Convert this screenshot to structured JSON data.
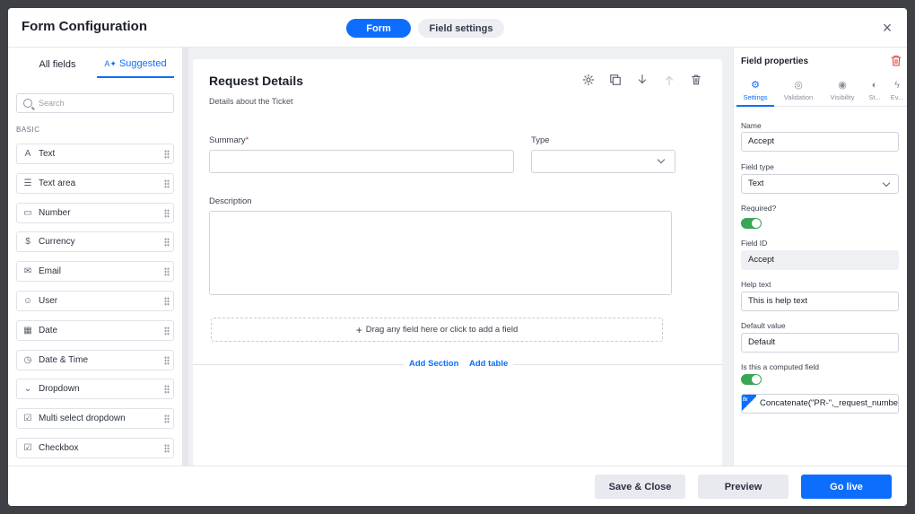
{
  "header": {
    "title": "Form Configuration",
    "tab_form": "Form",
    "tab_field_settings": "Field settings",
    "close": "×"
  },
  "left": {
    "tab_all": "All fields",
    "tab_suggested": "Suggested",
    "search_placeholder": "Search",
    "section": "BASIC",
    "items": [
      {
        "label": "Text",
        "icon": "text-icon"
      },
      {
        "label": "Text area",
        "icon": "text-area-icon"
      },
      {
        "label": "Number",
        "icon": "number-icon"
      },
      {
        "label": "Currency",
        "icon": "currency-icon"
      },
      {
        "label": "Email",
        "icon": "email-icon"
      },
      {
        "label": "User",
        "icon": "user-icon"
      },
      {
        "label": "Date",
        "icon": "calendar-icon"
      },
      {
        "label": "Date & Time",
        "icon": "date-time-icon"
      },
      {
        "label": "Dropdown",
        "icon": "dropdown-icon"
      },
      {
        "label": "Multi select dropdown",
        "icon": "multi-select-icon"
      },
      {
        "label": "Checkbox",
        "icon": "checkbox-icon"
      }
    ]
  },
  "canvas": {
    "title": "Request Details",
    "subtitle": "Details about the Ticket",
    "summary_label": "Summary",
    "required_mark": "*",
    "type_label": "Type",
    "description_label": "Description",
    "dropzone": "Drag any field here or click to add a field",
    "add_section": "Add Section",
    "add_table": "Add table"
  },
  "props": {
    "title": "Field properties",
    "tabs": [
      "Settings",
      "Validation",
      "Visibility",
      "St...",
      "Ev..."
    ],
    "name_label": "Name",
    "name_value": "Accept",
    "type_label": "Field type",
    "type_value": "Text",
    "required_label": "Required?",
    "field_id_label": "Field ID",
    "field_id_value": "Accept",
    "help_label": "Help text",
    "help_value": "This is help text",
    "default_label": "Default value",
    "default_value": "Default",
    "computed_label": "Is this a computed field",
    "formula": "Concatenate(\"PR-\",_request_number)",
    "fx": "fx"
  },
  "footer": {
    "save_close": "Save & Close",
    "preview": "Preview",
    "go_live": "Go live"
  },
  "colors": {
    "accent": "#0d6efd",
    "toggle_on": "#3aa655",
    "danger": "#d33333"
  }
}
